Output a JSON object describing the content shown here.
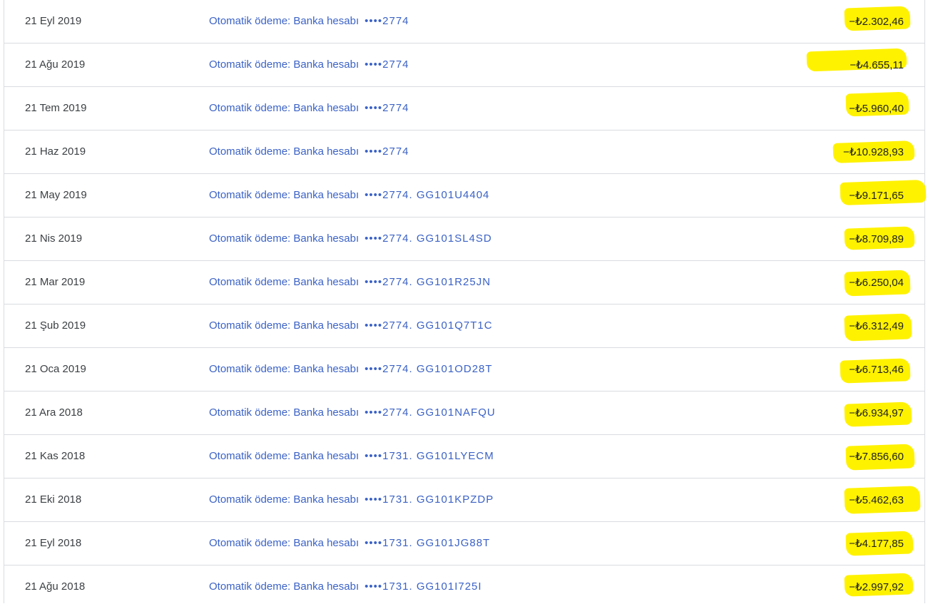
{
  "transactions": [
    {
      "date": "21 Eyl 2019",
      "description": "Otomatik ödeme: Banka hesabı",
      "account": "••••2774",
      "amount": "−₺2.302,46",
      "highlight_color": "#fff200"
    },
    {
      "date": "21 Ağu 2019",
      "description": "Otomatik ödeme: Banka hesabı",
      "account": "••••2774",
      "amount": "−₺4.655,11",
      "highlight_color": "#fff200"
    },
    {
      "date": "21 Tem 2019",
      "description": "Otomatik ödeme: Banka hesabı",
      "account": "••••2774",
      "amount": "−₺5.960,40",
      "highlight_color": "#fff200"
    },
    {
      "date": "21 Haz 2019",
      "description": "Otomatik ödeme: Banka hesabı",
      "account": "••••2774",
      "amount": "−₺10.928,93",
      "highlight_color": "#fff200"
    },
    {
      "date": "21 May 2019",
      "description": "Otomatik ödeme: Banka hesabı",
      "account": "••••2774. GG101U4404",
      "amount": "−₺9.171,65",
      "highlight_color": "#fff200"
    },
    {
      "date": "21 Nis 2019",
      "description": "Otomatik ödeme: Banka hesabı",
      "account": "••••2774. GG101SL4SD",
      "amount": "−₺8.709,89",
      "highlight_color": "#fff200"
    },
    {
      "date": "21 Mar 2019",
      "description": "Otomatik ödeme: Banka hesabı",
      "account": "••••2774. GG101R25JN",
      "amount": "−₺6.250,04",
      "highlight_color": "#fff200"
    },
    {
      "date": "21 Şub 2019",
      "description": "Otomatik ödeme: Banka hesabı",
      "account": "••••2774. GG101Q7T1C",
      "amount": "−₺6.312,49",
      "highlight_color": "#fff200"
    },
    {
      "date": "21 Oca 2019",
      "description": "Otomatik ödeme: Banka hesabı",
      "account": "••••2774. GG101OD28T",
      "amount": "−₺6.713,46",
      "highlight_color": "#fff200"
    },
    {
      "date": "21 Ara 2018",
      "description": "Otomatik ödeme: Banka hesabı",
      "account": "••••2774. GG101NAFQU",
      "amount": "−₺6.934,97",
      "highlight_color": "#fff200"
    },
    {
      "date": "21 Kas 2018",
      "description": "Otomatik ödeme: Banka hesabı",
      "account": "••••1731. GG101LYECM",
      "amount": "−₺7.856,60",
      "highlight_color": "#fff200"
    },
    {
      "date": "21 Eki 2018",
      "description": "Otomatik ödeme: Banka hesabı",
      "account": "••••1731. GG101KPZDP",
      "amount": "−₺5.462,63",
      "highlight_color": "#fff200"
    },
    {
      "date": "21 Eyl 2018",
      "description": "Otomatik ödeme: Banka hesabı",
      "account": "••••1731. GG101JG88T",
      "amount": "−₺4.177,85",
      "highlight_color": "#fff200"
    },
    {
      "date": "21 Ağu 2018",
      "description": "Otomatik ödeme: Banka hesabı",
      "account": "••••1731. GG101I725I",
      "amount": "−₺2.997,92",
      "highlight_color": "#fff200"
    }
  ],
  "colors": {
    "link": "#3b62c6",
    "text": "#3c4043",
    "divider": "#dadce0",
    "highlight": "#fff200"
  }
}
